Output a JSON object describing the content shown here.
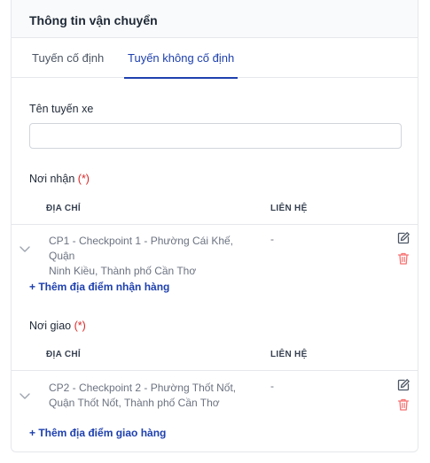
{
  "card": {
    "title": "Thông tin vận chuyển"
  },
  "tabs": [
    {
      "label": "Tuyến cố định",
      "active": false
    },
    {
      "label": "Tuyến không cố định",
      "active": true
    }
  ],
  "route_name": {
    "label": "Tên tuyến xe",
    "value": "",
    "placeholder": ""
  },
  "pickup": {
    "label": "Nơi nhận",
    "required_mark": "(*)",
    "columns": {
      "address": "ĐỊA CHỈ",
      "contact": "LIÊN HỆ"
    },
    "rows": [
      {
        "address_line1": "CP1 - Checkpoint 1 - Phường Cái Khế, Quận",
        "address_line2": "Ninh Kiều, Thành phố Cần Thơ",
        "contact": "-"
      }
    ],
    "add_label": "+ Thêm địa điểm nhận hàng"
  },
  "delivery": {
    "label": "Nơi giao",
    "required_mark": "(*)",
    "columns": {
      "address": "ĐỊA CHỈ",
      "contact": "LIÊN HỆ"
    },
    "rows": [
      {
        "address_line1": "CP2 - Checkpoint 2 - Phường Thốt Nốt,",
        "address_line2": "Quận Thốt Nốt, Thành phố Cần Thơ",
        "contact": "-"
      }
    ],
    "add_label": "+ Thêm địa điểm giao hàng"
  },
  "colors": {
    "accent": "#1e40af",
    "required": "#dc2626",
    "delete": "#f87171"
  },
  "icons": {
    "expand": "chevron-down-icon",
    "edit": "edit-icon",
    "delete": "trash-icon"
  }
}
